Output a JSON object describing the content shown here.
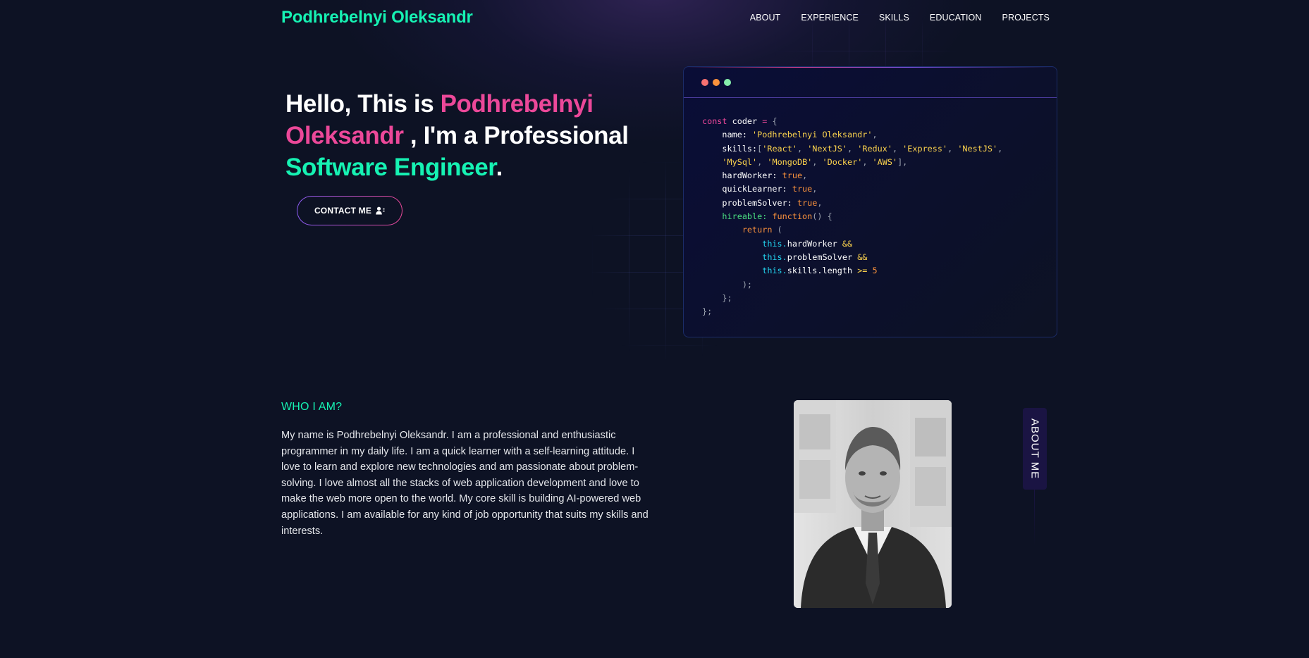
{
  "navbar": {
    "brand": "Podhrebelnyi Oleksandr",
    "links": [
      "ABOUT",
      "EXPERIENCE",
      "SKILLS",
      "EDUCATION",
      "PROJECTS"
    ]
  },
  "hero": {
    "greeting": "Hello, This is ",
    "name": "Podhrebelnyi Oleksandr",
    "middle": " , I'm a Professional ",
    "role": "Software Engineer",
    "period": ".",
    "contact_label": "CONTACT ME",
    "contact_icon": "user-contact-icon"
  },
  "code": {
    "lines": [
      [
        [
          "const",
          "pink"
        ],
        [
          " coder ",
          "white"
        ],
        [
          "=",
          "pink"
        ],
        [
          " {",
          "gray"
        ]
      ],
      [
        [
          "    name:",
          "white"
        ],
        [
          " 'Podhrebelnyi Oleksandr'",
          "amber"
        ],
        [
          ",",
          "gray"
        ]
      ],
      [
        [
          "    skills:",
          "white"
        ],
        [
          "[",
          "gray"
        ],
        [
          "'React'",
          "amber"
        ],
        [
          ", ",
          "gray"
        ],
        [
          "'NextJS'",
          "amber"
        ],
        [
          ", ",
          "gray"
        ],
        [
          "'Redux'",
          "amber"
        ],
        [
          ", ",
          "gray"
        ],
        [
          "'Express'",
          "amber"
        ],
        [
          ", ",
          "gray"
        ],
        [
          "'NestJS'",
          "amber"
        ],
        [
          ",",
          "gray"
        ]
      ],
      [
        [
          "    ",
          "white"
        ],
        [
          "'MySql'",
          "amber"
        ],
        [
          ", ",
          "gray"
        ],
        [
          "'MongoDB'",
          "amber"
        ],
        [
          ", ",
          "gray"
        ],
        [
          "'Docker'",
          "amber"
        ],
        [
          ", ",
          "gray"
        ],
        [
          "'AWS'",
          "amber"
        ],
        [
          "],",
          "gray"
        ]
      ],
      [
        [
          "    hardWorker:",
          "white"
        ],
        [
          " true",
          "orange"
        ],
        [
          ",",
          "gray"
        ]
      ],
      [
        [
          "    quickLearner:",
          "white"
        ],
        [
          " true",
          "orange"
        ],
        [
          ",",
          "gray"
        ]
      ],
      [
        [
          "    problemSolver:",
          "white"
        ],
        [
          " true",
          "orange"
        ],
        [
          ",",
          "gray"
        ]
      ],
      [
        [
          "    hireable:",
          "green"
        ],
        [
          " function",
          "orange"
        ],
        [
          "() {",
          "gray"
        ]
      ],
      [
        [
          "        return",
          "orange"
        ],
        [
          " (",
          "gray"
        ]
      ],
      [
        [
          "            this.",
          "cyan"
        ],
        [
          "hardWorker",
          "white"
        ],
        [
          " &&",
          "amber"
        ]
      ],
      [
        [
          "            this.",
          "cyan"
        ],
        [
          "problemSolver",
          "white"
        ],
        [
          " &&",
          "amber"
        ]
      ],
      [
        [
          "            this.",
          "cyan"
        ],
        [
          "skills.length",
          "white"
        ],
        [
          " >=",
          "amber"
        ],
        [
          " 5",
          "orange"
        ]
      ],
      [
        [
          "        );",
          "gray"
        ]
      ],
      [
        [
          "    };",
          "gray"
        ]
      ],
      [
        [
          "};",
          "gray"
        ]
      ]
    ]
  },
  "about": {
    "label": "WHO I AM?",
    "text": "My name is Podhrebelnyi Oleksandr. I am a professional and enthusiastic programmer in my daily life. I am a quick learner with a self-learning attitude. I love to learn and explore new technologies and am passionate about problem-solving. I love almost all the stacks of web application development and love to make the web more open to the world. My core skill is building AI-powered web applications. I am available for any kind of job opportunity that suits my skills and interests.",
    "side_tag": "ABOUT ME"
  }
}
